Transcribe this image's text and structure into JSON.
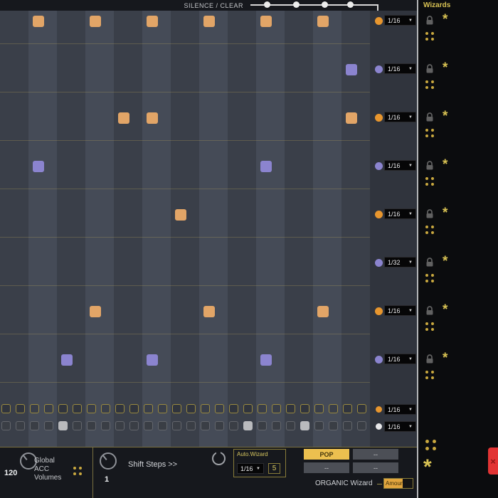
{
  "icons": {
    "chevron_down": "▼",
    "asterisk": "*",
    "close": "×"
  },
  "accent_colors": {
    "orange": "#e2a567",
    "purple": "#8b84cf",
    "yellow": "#d8c253",
    "olive_border": "#8a7d3a",
    "red": "#e23434"
  },
  "top_bar": {
    "silence_clear_label": "SILENCE / CLEAR"
  },
  "wizards_panel": {
    "header": "Wizards"
  },
  "sequencer": {
    "visible_columns": 13,
    "rows": [
      {
        "name": "track-1",
        "rate": "1/16",
        "step_color": "#e2a567",
        "dot_color": "#e8962e",
        "steps": [
          1,
          3,
          5,
          7,
          9,
          11
        ]
      },
      {
        "name": "track-2",
        "rate": "1/16",
        "step_color": "#8b84cf",
        "dot_color": "#8b84cf",
        "steps": [
          12
        ]
      },
      {
        "name": "track-3",
        "rate": "1/16",
        "step_color": "#e2a567",
        "dot_color": "#e8962e",
        "steps": [
          4,
          5,
          12
        ]
      },
      {
        "name": "track-4",
        "rate": "1/16",
        "step_color": "#8b84cf",
        "dot_color": "#8b84cf",
        "steps": [
          1,
          9
        ]
      },
      {
        "name": "track-5",
        "rate": "1/16",
        "step_color": "#e2a567",
        "dot_color": "#e8962e",
        "steps": [
          6
        ]
      },
      {
        "name": "track-6",
        "rate": "1/32",
        "step_color": "#8b84cf",
        "dot_color": "#8b84cf",
        "steps": []
      },
      {
        "name": "track-7",
        "rate": "1/16",
        "step_color": "#e2a567",
        "dot_color": "#e8962e",
        "steps": [
          3,
          7,
          11
        ]
      },
      {
        "name": "track-8",
        "rate": "1/16",
        "step_color": "#8b84cf",
        "dot_color": "#8b84cf",
        "steps": [
          2,
          5,
          9
        ]
      }
    ],
    "mini_rows": [
      {
        "name": "accent-lane",
        "style": "accent",
        "rate": "1/16",
        "dot_color": "#e8962e",
        "cells": 26,
        "filled": []
      },
      {
        "name": "gate-lane",
        "style": "gray",
        "rate": "1/16",
        "dot_color": "#e8e8ea",
        "cells": 26,
        "filled": [
          4,
          17,
          21
        ]
      }
    ]
  },
  "bottom_bar": {
    "tempo_value": "120",
    "global_acc_lines": [
      "Global",
      "ACC",
      "Volumes"
    ],
    "shift_value": "1",
    "shift_label": "Shift Steps >>",
    "auto_wizard": {
      "label": "Auto.Wizard",
      "rate": "1/16",
      "count": "5"
    },
    "preset_buttons": [
      {
        "label": "POP"
      },
      {
        "label": "--"
      },
      {
        "label": "--"
      },
      {
        "label": "--"
      }
    ],
    "organic_label": "ORGANIC Wizard",
    "organic_value": "Amount"
  }
}
